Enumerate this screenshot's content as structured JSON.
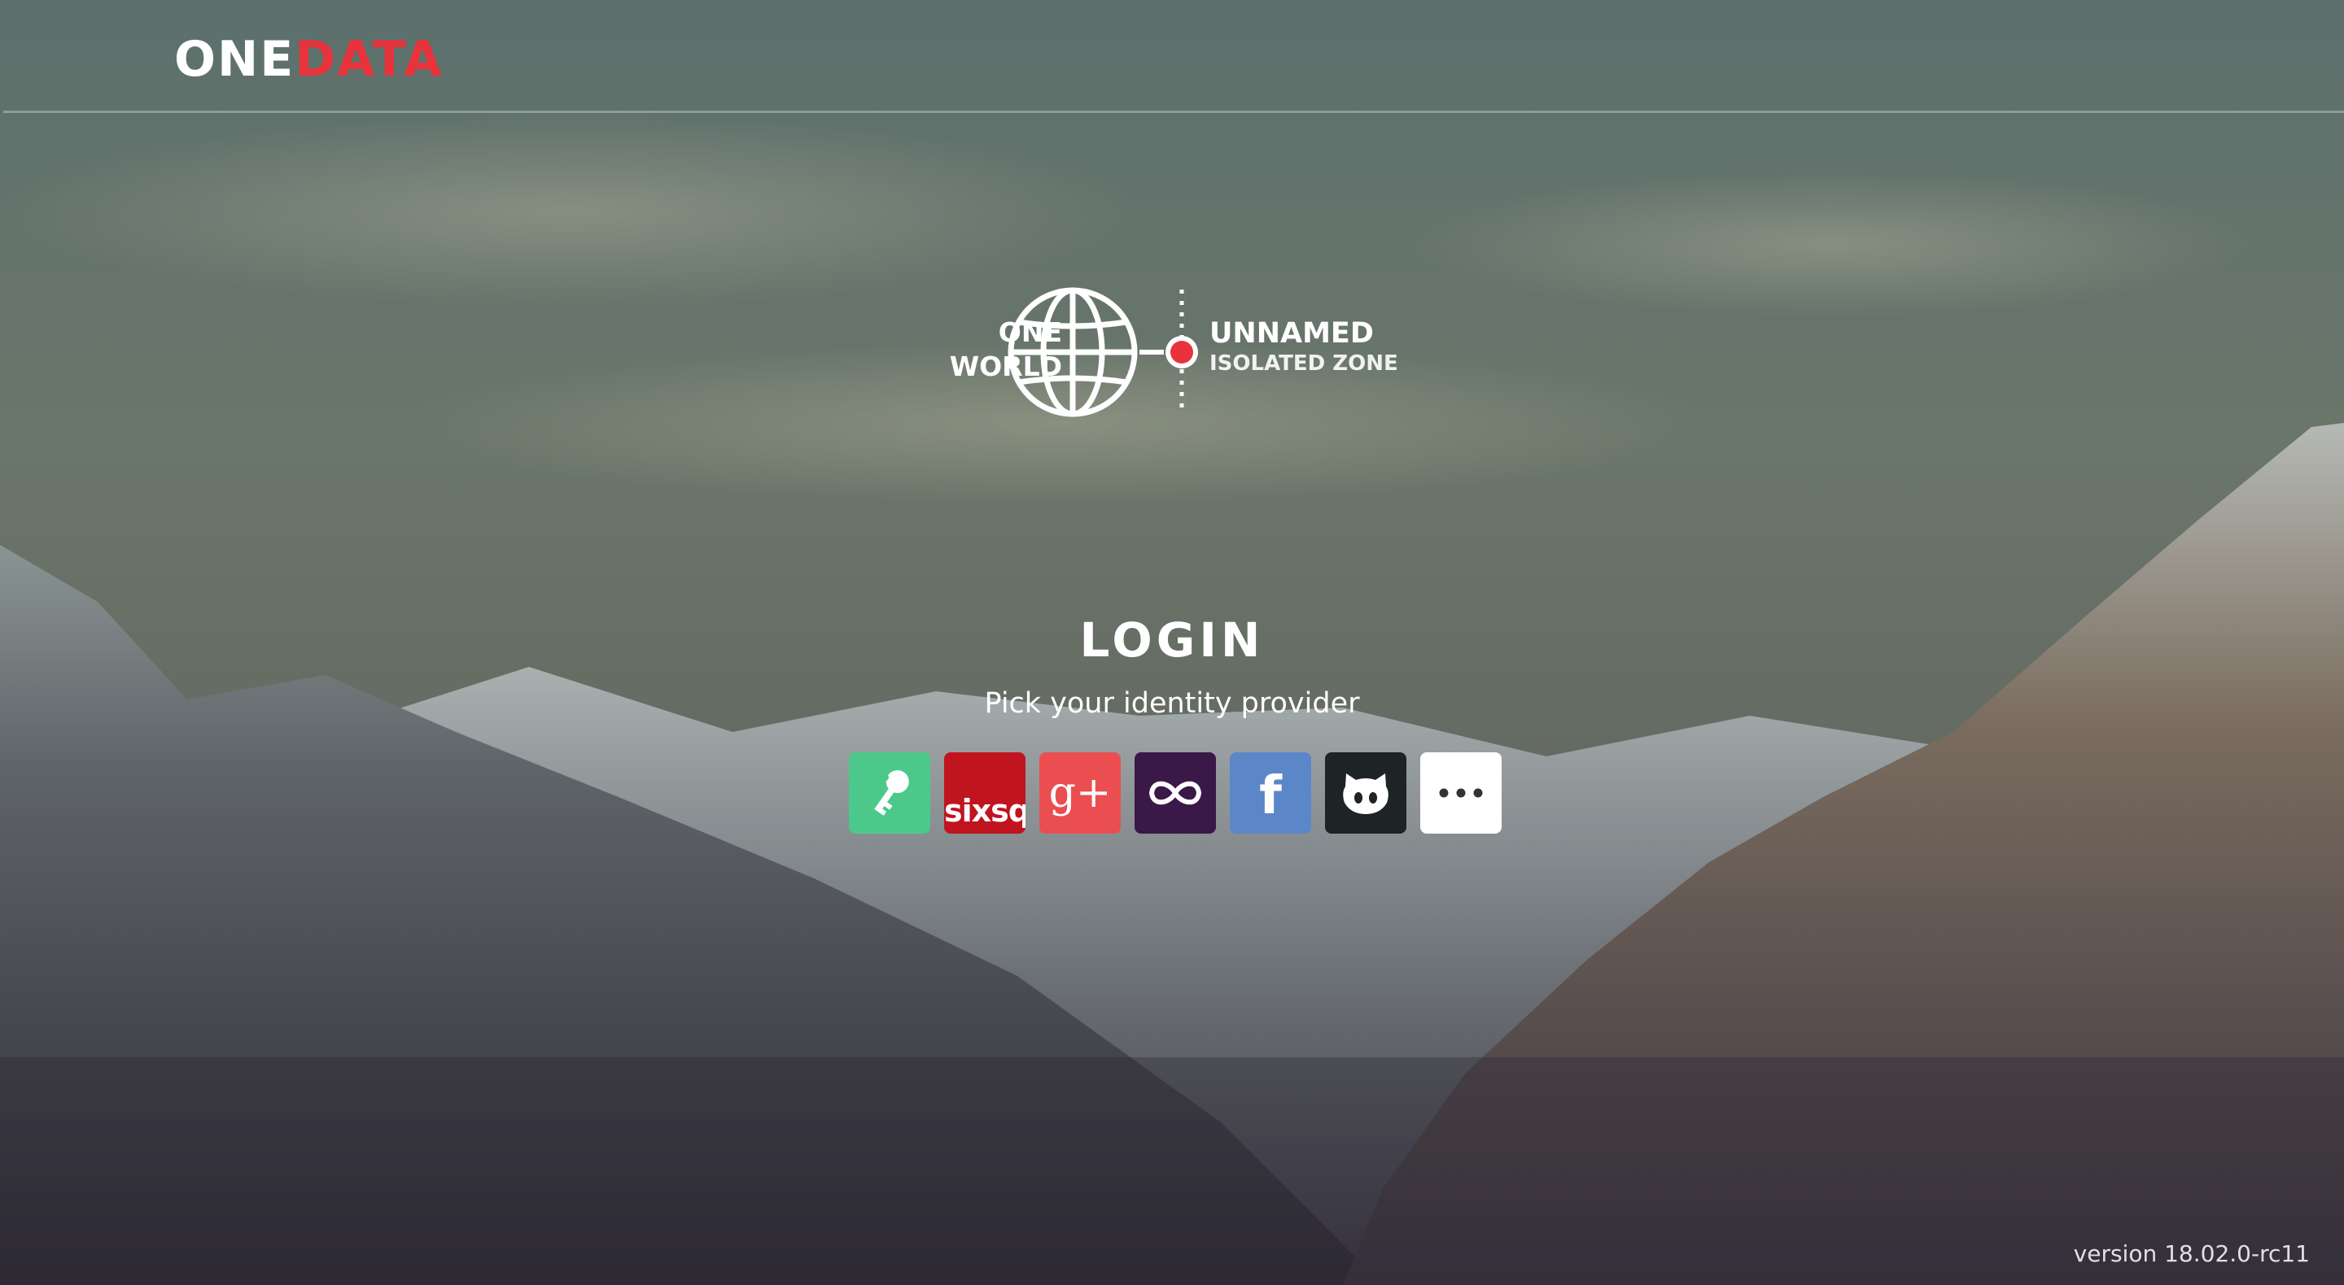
{
  "header": {
    "logo_text_white": "ONE",
    "logo_text_red": "DATA"
  },
  "zone": {
    "world_line1": "ONE",
    "world_line2": "WORLD",
    "name": "UNNAMED",
    "subtitle": "ISOLATED ZONE"
  },
  "login": {
    "title": "LOGIN",
    "subtitle": "Pick your identity provider",
    "providers": [
      {
        "id": "basic",
        "icon": "key-icon",
        "color": "#4cc98a"
      },
      {
        "id": "sixsq",
        "icon": "sixsq-logo",
        "label": "sixsq.",
        "color": "#c0141f"
      },
      {
        "id": "google",
        "icon": "google-plus-icon",
        "label": "g+",
        "color": "#ea4e51"
      },
      {
        "id": "egi",
        "icon": "egi-infinity-icon",
        "color": "#3a1848"
      },
      {
        "id": "facebook",
        "icon": "facebook-icon",
        "label": "f",
        "color": "#5b86c8"
      },
      {
        "id": "github",
        "icon": "github-octocat-icon",
        "color": "#1e2326"
      },
      {
        "id": "more",
        "icon": "more-dots-icon",
        "color": "#ffffff"
      }
    ]
  },
  "footer": {
    "version": "version 18.02.0-rc11"
  },
  "colors": {
    "brand_red": "#e8323c",
    "zone_marker": "#e8323c"
  }
}
